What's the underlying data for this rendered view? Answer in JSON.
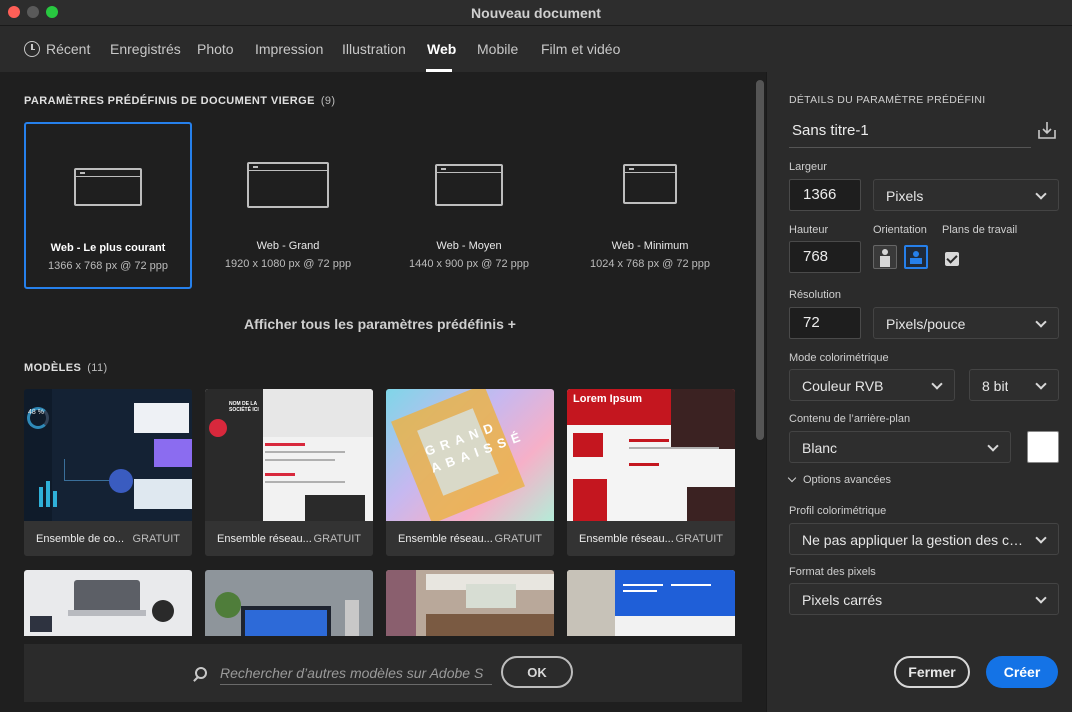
{
  "window": {
    "title": "Nouveau document"
  },
  "tabs": [
    {
      "label": "Récent"
    },
    {
      "label": "Enregistrés"
    },
    {
      "label": "Photo"
    },
    {
      "label": "Impression"
    },
    {
      "label": "Illustration"
    },
    {
      "label": "Web"
    },
    {
      "label": "Mobile"
    },
    {
      "label": "Film et vidéo"
    }
  ],
  "active_tab": "Web",
  "presets_section": {
    "title": "PARAMÈTRES PRÉDÉFINIS DE DOCUMENT VIERGE",
    "count": "(9)"
  },
  "presets": [
    {
      "name": "Web - Le plus courant",
      "dims": "1366 x 768 px @ 72 ppp",
      "selected": true
    },
    {
      "name": "Web - Grand",
      "dims": "1920 x 1080 px @ 72 ppp"
    },
    {
      "name": "Web - Moyen",
      "dims": "1440 x 900 px @ 72 ppp"
    },
    {
      "name": "Web - Minimum",
      "dims": "1024 x 768 px @ 72 ppp"
    }
  ],
  "show_all_label": "Afficher tous les paramètres prédéfinis +",
  "templates_section": {
    "title": "MODÈLES",
    "count": "(11)"
  },
  "templates": [
    {
      "name": "Ensemble de co...",
      "price": "GRATUIT",
      "thumb_text": "48 %"
    },
    {
      "name": "Ensemble réseau...",
      "price": "GRATUIT",
      "thumb_text": "NOM DE LA SOCIÉTÉ ICI"
    },
    {
      "name": "Ensemble réseau...",
      "price": "GRATUIT",
      "thumb_text": "GRAND ABAISSÉ"
    },
    {
      "name": "Ensemble réseau...",
      "price": "GRATUIT",
      "thumb_text": "Lorem Ipsum"
    }
  ],
  "search": {
    "placeholder": "Rechercher d’autres modèles sur Adobe S",
    "ok_label": "OK"
  },
  "details": {
    "title": "DÉTAILS DU PARAMÈTRE PRÉDÉFINI",
    "doc_name": "Sans titre-1",
    "width_label": "Largeur",
    "width_value": "1366",
    "width_unit": "Pixels",
    "height_label": "Hauteur",
    "height_value": "768",
    "orientation_label": "Orientation",
    "artboards_label": "Plans de travail",
    "artboards_checked": true,
    "resolution_label": "Résolution",
    "resolution_value": "72",
    "resolution_unit": "Pixels/pouce",
    "color_mode_label": "Mode colorimétrique",
    "color_mode": "Couleur RVB",
    "bit_depth": "8 bit",
    "background_label": "Contenu de l’arrière-plan",
    "background": "Blanc",
    "background_color": "#ffffff",
    "advanced_label": "Options avancées",
    "color_profile_label": "Profil colorimétrique",
    "color_profile": "Ne pas appliquer la gestion des couleurs",
    "pixel_format_label": "Format des pixels",
    "pixel_format": "Pixels carrés",
    "close_label": "Fermer",
    "create_label": "Créer"
  },
  "colors": {
    "accent": "#1473e6",
    "selection": "#2680eb"
  }
}
